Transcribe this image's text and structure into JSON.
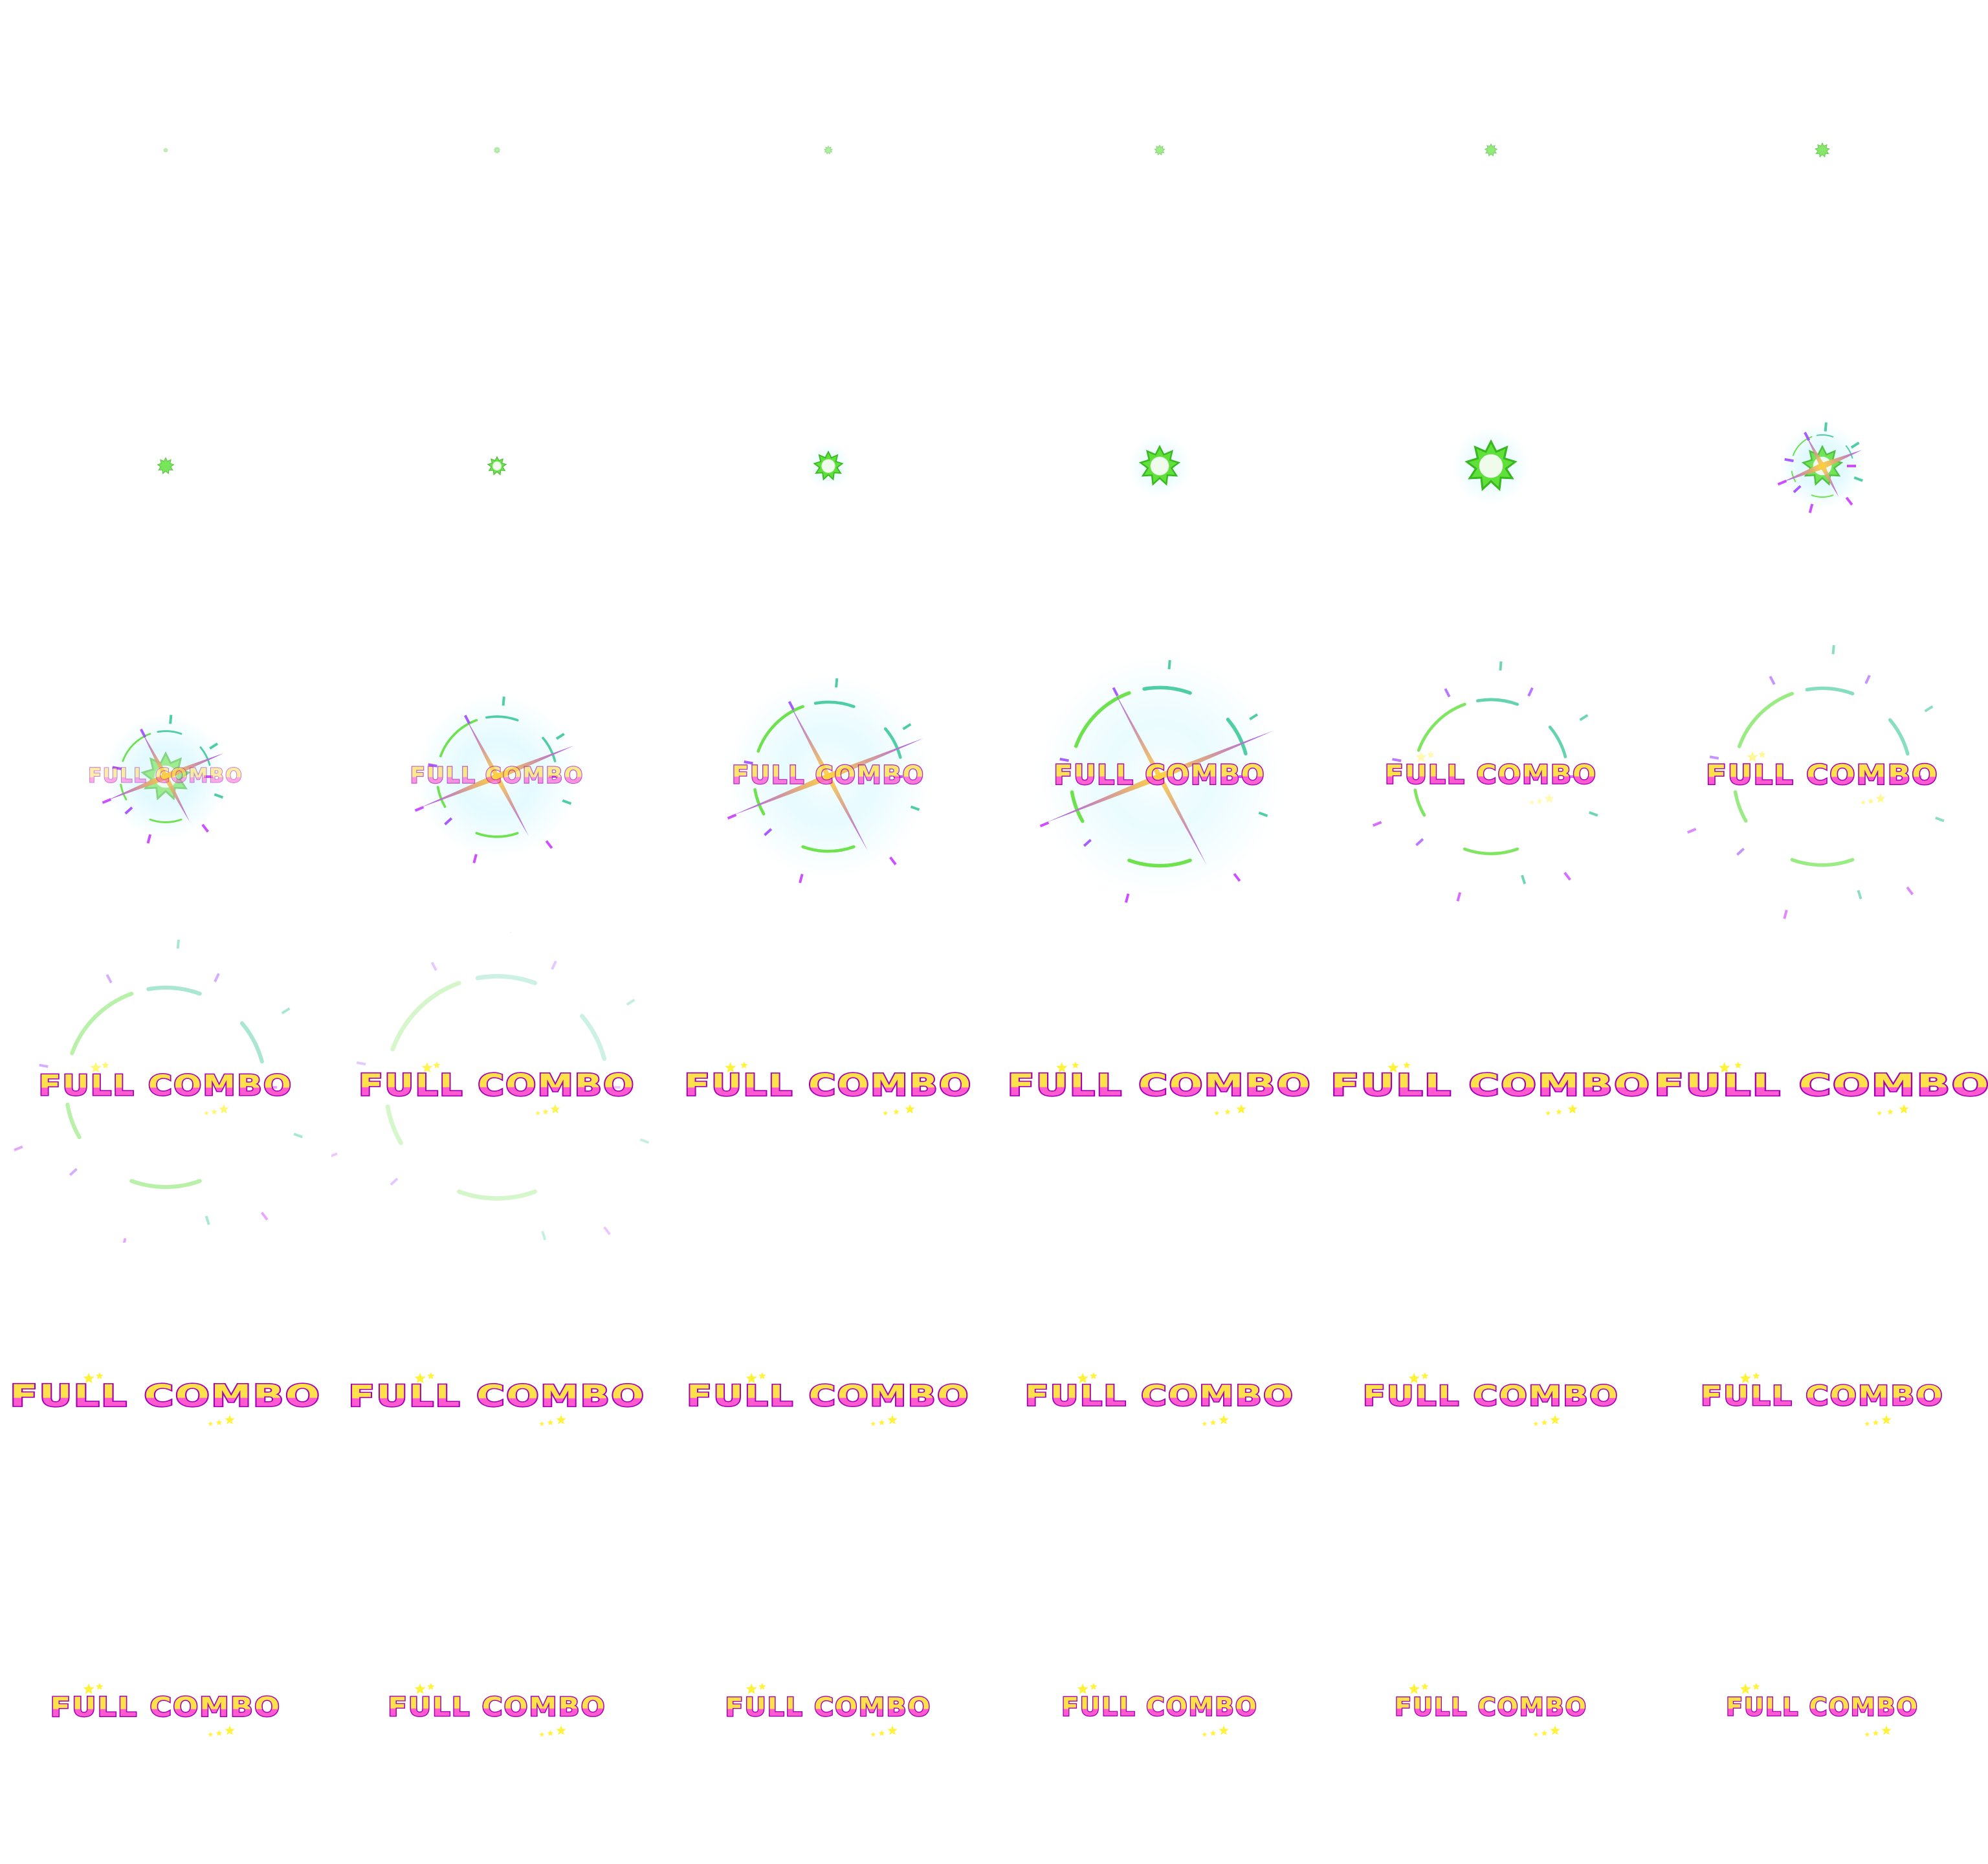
{
  "sheet": {
    "columns": 6,
    "rows": 6,
    "frame_count": 36,
    "background": "#ffffff"
  },
  "banner": {
    "text": "FULL COMBO"
  },
  "colors": {
    "text_fill_top": "#ffe14a",
    "text_fill_bottom": "#ff5ad0",
    "text_outline": "#a400b8",
    "burst_green": "#5fe03a",
    "burst_green_dark": "#36b81e",
    "flash_white": "#ffffff",
    "glow_cyan": "#bff4ff",
    "streak_gold": "#ffd23a",
    "streak_purple": "#a04bff",
    "arc_teal": "#3ec99a",
    "star_yellow": "#fff23a",
    "shard_magenta": "#c93cff"
  },
  "icons": {
    "burst": "green-starburst-icon",
    "streak": "light-streak-icon",
    "spark": "spark-icon",
    "star": "star-icon"
  }
}
